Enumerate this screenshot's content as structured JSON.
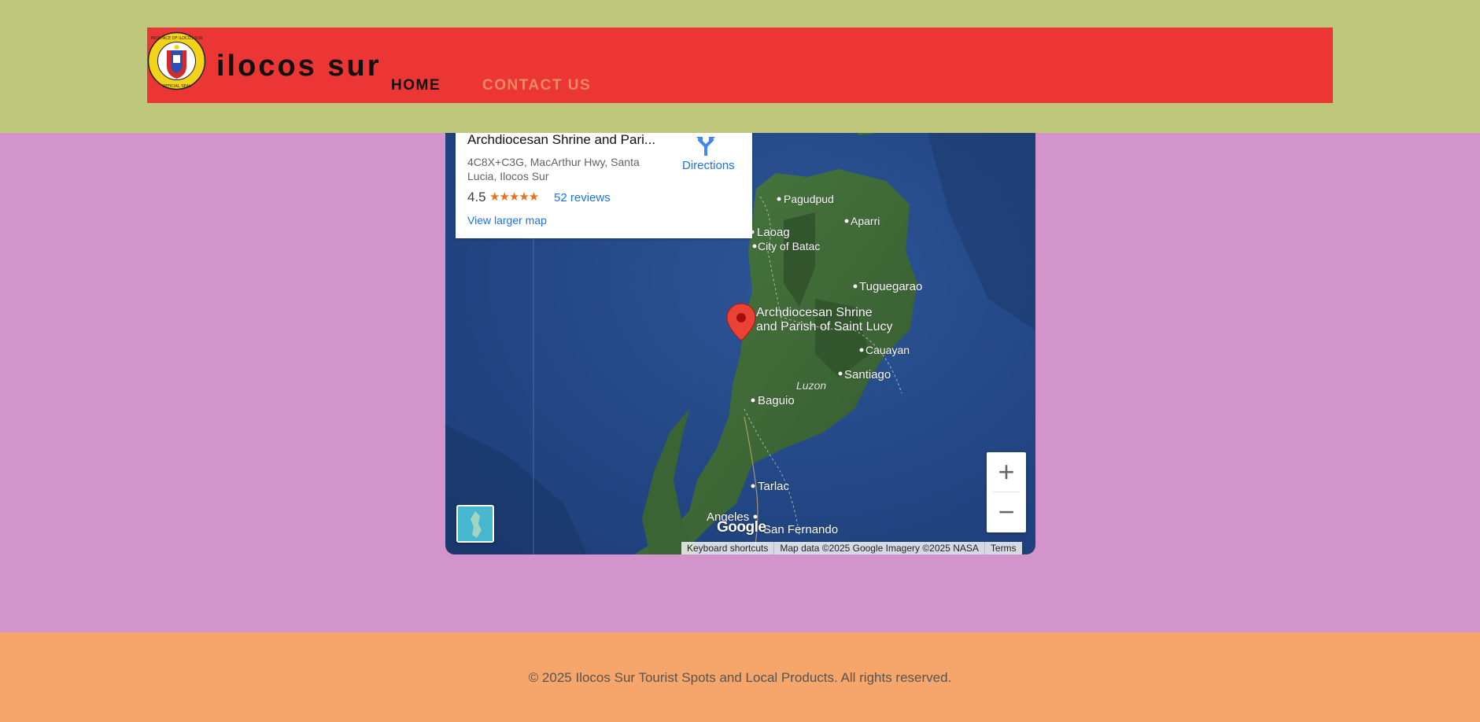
{
  "site": {
    "title": "ilocos sur",
    "nav": [
      {
        "label": "HOME",
        "active": true
      },
      {
        "label": "CONTACT US",
        "active": false
      }
    ],
    "seal_text": [
      "PROVINCE OF ILOCOS SUR",
      "OFFICIAL SEAL"
    ]
  },
  "map": {
    "info_card": {
      "name": "Archdiocesan Shrine and Pari...",
      "address": "4C8X+C3G, MacArthur Hwy, Santa Lucia, Ilocos Sur",
      "rating": "4.5",
      "stars": "★★★★★",
      "reviews": "52 reviews",
      "larger_map": "View larger map",
      "directions": "Directions"
    },
    "marker_label": [
      "Archdiocesan Shrine",
      "and Parish of Saint Lucy"
    ],
    "places": [
      "Pagudpud",
      "Aparri",
      "Laoag",
      "City of Batac",
      "Tuguegarao",
      "Cauayan",
      "Santiago",
      "Luzon",
      "Baguio",
      "Tarlac",
      "Angeles",
      "San Fernando"
    ],
    "zoom_in": "+",
    "zoom_out": "−",
    "logo": "Google",
    "attribution": {
      "shortcuts": "Keyboard shortcuts",
      "data": "Map data ©2025 Google Imagery ©2025 NASA",
      "terms": "Terms"
    },
    "colors": {
      "ocean": "#244a8c",
      "land": "#3f6b3a",
      "marker": "#ea4335"
    }
  },
  "footer": {
    "text": "© 2025 Ilocos Sur Tourist Spots and Local Products. All rights reserved."
  },
  "colors": {
    "header_band": "#bfc77c",
    "nav_bar": "#ec3535",
    "page_bg": "#d394cb",
    "footer_bg": "#f6a66b",
    "contact_link": "#f08a60"
  }
}
